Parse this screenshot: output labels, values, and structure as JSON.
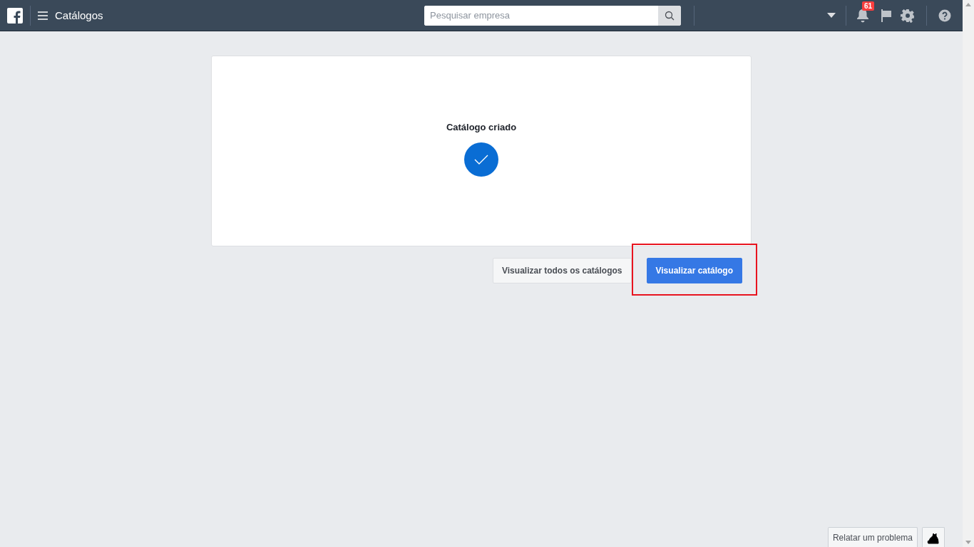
{
  "topbar": {
    "title": "Catálogos",
    "search": {
      "placeholder": "Pesquisar empresa"
    },
    "notification_count": "61"
  },
  "card": {
    "message": "Catálogo criado"
  },
  "actions": [
    {
      "label": "Visualizar todos os catálogos",
      "kind": "secondary",
      "highlighted": false
    },
    {
      "label": "Visualizar catálogo",
      "kind": "primary",
      "highlighted": true
    }
  ],
  "footer": {
    "report_label": "Relatar um problema"
  }
}
